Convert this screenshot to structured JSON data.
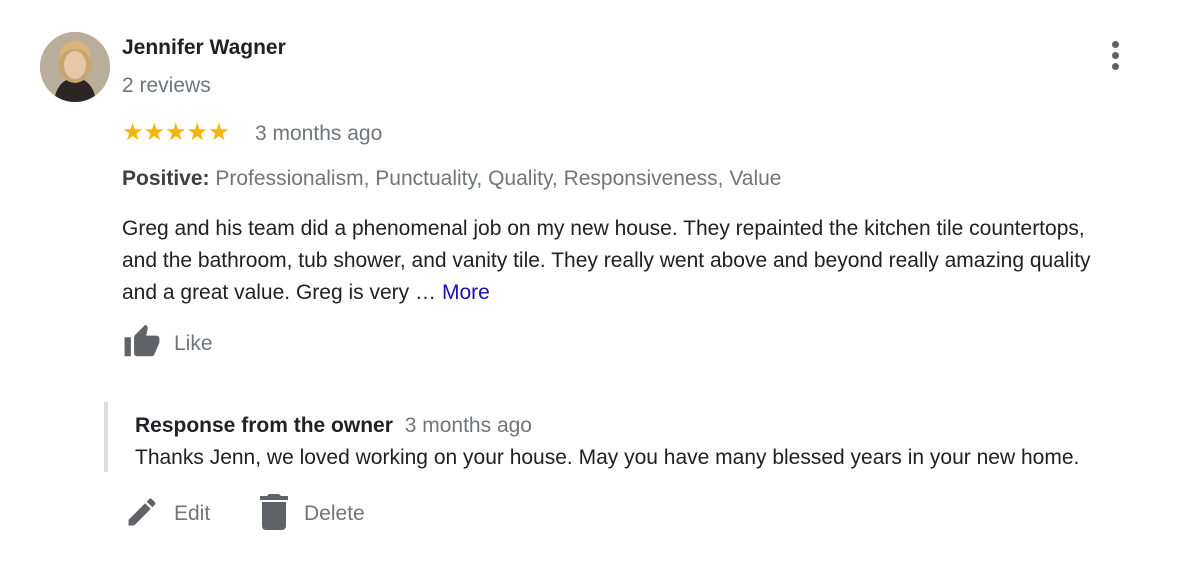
{
  "reviewer": {
    "name": "Jennifer Wagner",
    "review_count": "2 reviews"
  },
  "review": {
    "rating": 5,
    "stars": "★★★★★",
    "date": "3 months ago",
    "positive_label": "Positive:",
    "positive_values": "Professionalism, Punctuality, Quality, Responsiveness, Value",
    "text_lines": [
      "Greg and his team did a phenomenal job on my new house. They repainted the kitchen tile countertops,",
      "and the bathroom, tub shower, and vanity tile. They really went above and beyond really amazing quality",
      "and a great value. Greg is very …"
    ],
    "more_label": "More",
    "like_label": "Like"
  },
  "owner_response": {
    "title": "Response from the owner",
    "date": "3 months ago",
    "text": "Thanks Jenn, we loved working on your house. May you have many blessed years in your new home."
  },
  "actions": {
    "edit_label": "Edit",
    "delete_label": "Delete"
  },
  "icons": {
    "menu": "more-vert-icon",
    "like": "thumb-up-icon",
    "edit": "pencil-icon",
    "delete": "trash-icon"
  },
  "colors": {
    "star": "#f4b400",
    "link": "#1a0dab",
    "secondary_text": "#70757a",
    "primary_text": "#202124",
    "icon": "#5f6368"
  }
}
